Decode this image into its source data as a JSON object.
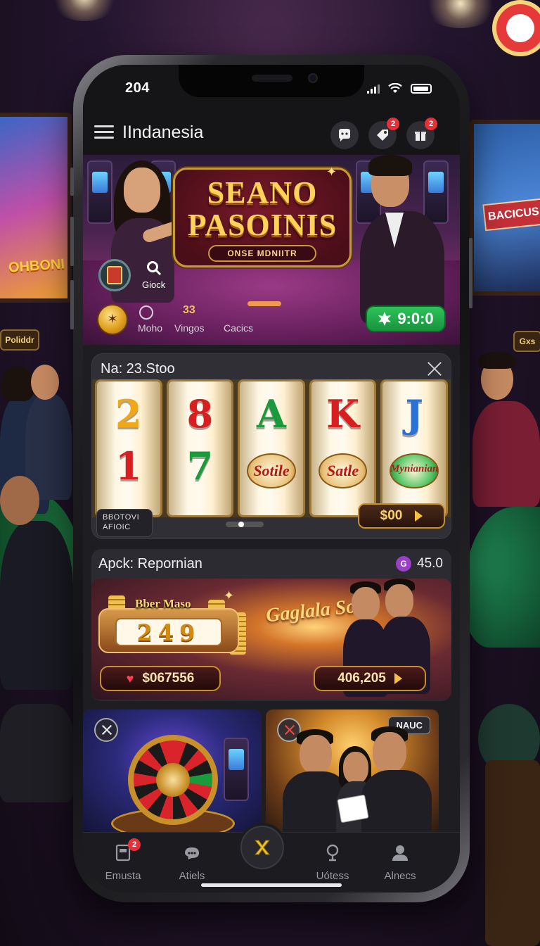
{
  "status_bar": {
    "time": "204"
  },
  "header": {
    "title": "IIndanesia",
    "notif_badges": [
      "2",
      "2"
    ]
  },
  "hero": {
    "logo_line1": "SEANO",
    "logo_line2": "PASOINIS",
    "logo_tagline": "ONSE MDNIITR",
    "search_label": "Giock",
    "stats": [
      {
        "label": "Moho",
        "value": ""
      },
      {
        "label": "Vingos",
        "value": "33"
      },
      {
        "label": "Cacics",
        "value": ""
      }
    ],
    "play_button_label": "9:0:0"
  },
  "slot_card": {
    "title": "Na: 23.Stoo",
    "reel_symbols": [
      [
        "2",
        "1"
      ],
      [
        "8",
        "7"
      ],
      [
        "A",
        "Sotile"
      ],
      [
        "K",
        "Satle"
      ],
      [
        "J",
        "Mynianian"
      ]
    ],
    "footer_left": "BBOTOVI AFIOIC",
    "bet_value": "$00"
  },
  "promo": {
    "title": "Apck: Repornian",
    "balance": "45.0",
    "balance_icon": "gem-icon",
    "counter_label": "Bber Maso",
    "counter_value": "249",
    "script_text": "Gaglala Soice",
    "left_pill_value": "$067556",
    "right_pill_value": "406,205"
  },
  "tiles": {
    "people_tag": "NAUC"
  },
  "bottom_nav": {
    "items": [
      {
        "label": "Emusta",
        "icon": "slot-machine-icon",
        "badge": "2"
      },
      {
        "label": "Atiels",
        "icon": "chat-icon"
      },
      {
        "label": "Uótess",
        "icon": "trophy-icon"
      },
      {
        "label": "Alnecs",
        "icon": "profile-icon"
      }
    ]
  },
  "colors": {
    "accent_green": "#2fc25a",
    "gold": "#f8d070",
    "badge_red": "#e8303a"
  }
}
